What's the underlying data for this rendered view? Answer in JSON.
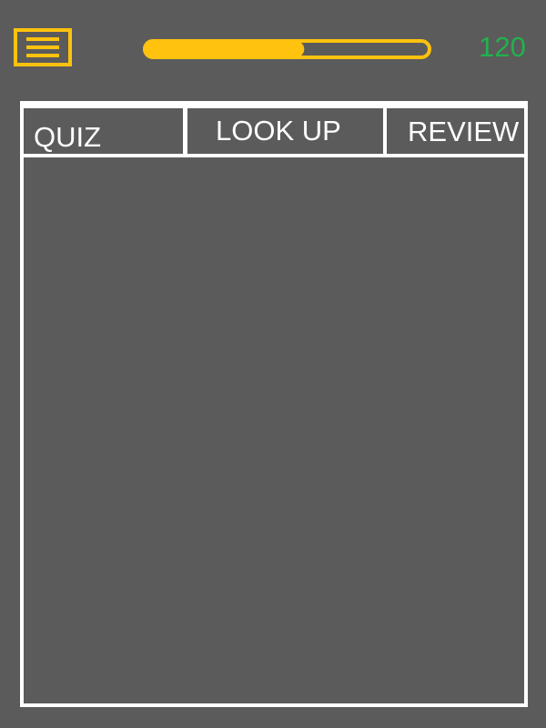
{
  "header": {
    "menu_icon": "hamburger-menu-icon",
    "progress_fraction": 0.56,
    "score": "120"
  },
  "tabs": [
    {
      "label": "QUIZ"
    },
    {
      "label": "LOOK UP"
    },
    {
      "label": "REVIEW"
    }
  ],
  "colors": {
    "background": "#5b5b5b",
    "accent": "#ffc20e",
    "score": "#22b14c",
    "outline": "#ffffff"
  }
}
